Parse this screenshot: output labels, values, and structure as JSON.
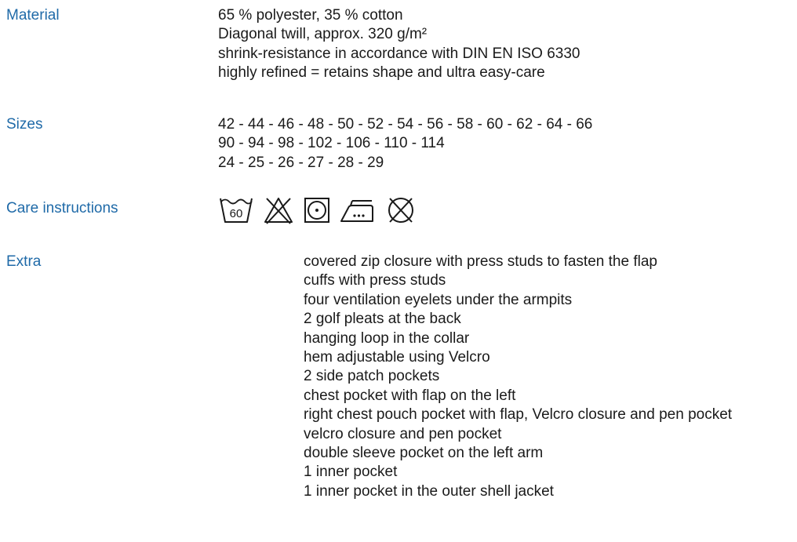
{
  "material": {
    "label": "Material",
    "lines": [
      "65 % polyester, 35 % cotton",
      "Diagonal twill, approx. 320 g/m²",
      "shrink-resistance in accordance with DIN EN ISO 6330",
      "highly refined = retains shape and ultra easy-care"
    ]
  },
  "sizes": {
    "label": "Sizes",
    "lines": [
      "42 - 44 - 46 - 48 - 50 - 52 - 54 - 56 - 58 - 60 - 62 - 64 - 66",
      "90 - 94 - 98 - 102 - 106 - 110 - 114",
      "24 - 25 - 26 - 27 - 28 - 29"
    ]
  },
  "care": {
    "label": "Care instructions",
    "icons": [
      "wash-60-icon",
      "do-not-bleach-icon",
      "tumble-dry-icon",
      "iron-medium-icon",
      "do-not-dry-clean-icon"
    ],
    "wash_temp": "60"
  },
  "extra": {
    "label": "Extra",
    "lines": [
      "covered zip closure with press studs to fasten the flap",
      "cuffs with press studs",
      "four ventilation eyelets under the armpits",
      "2 golf pleats at the back",
      "hanging loop in the collar",
      "hem adjustable using Velcro",
      "2 side patch pockets",
      "chest pocket with flap on the left",
      "right chest pouch pocket with flap, Velcro closure and pen pocket",
      "velcro closure and pen pocket",
      "double sleeve pocket on the left arm",
      "1 inner pocket",
      "1 inner pocket in the outer shell jacket"
    ]
  },
  "colors": {
    "label": "#1f6aa8",
    "text": "#1a1a1a"
  }
}
